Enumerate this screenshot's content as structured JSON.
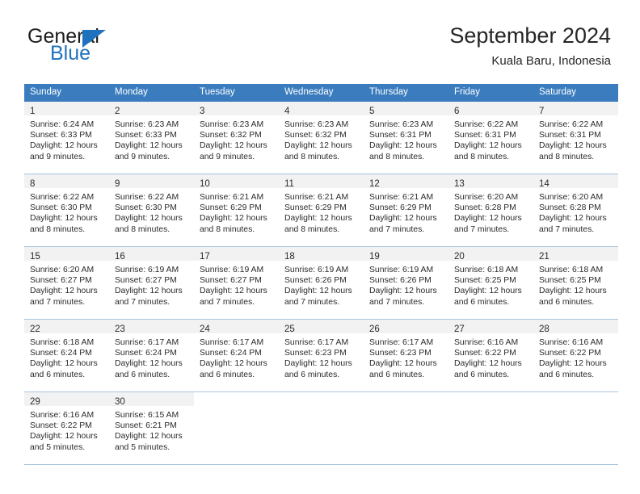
{
  "brand": {
    "word_one": "General",
    "word_two": "Blue",
    "flag_icon": "triangle-flag-icon",
    "accent_color": "#1f72bd"
  },
  "header": {
    "title": "September 2024",
    "location": "Kuala Baru, Indonesia"
  },
  "calendar": {
    "header_bg": "#3a7cbe",
    "daynum_bg": "#f2f2f2",
    "grid_line": "#a8c4dd",
    "weekdays": [
      "Sunday",
      "Monday",
      "Tuesday",
      "Wednesday",
      "Thursday",
      "Friday",
      "Saturday"
    ],
    "weeks": [
      [
        {
          "day": "1",
          "sunrise": "Sunrise: 6:24 AM",
          "sunset": "Sunset: 6:33 PM",
          "daylight_1": "Daylight: 12 hours",
          "daylight_2": "and 9 minutes."
        },
        {
          "day": "2",
          "sunrise": "Sunrise: 6:23 AM",
          "sunset": "Sunset: 6:33 PM",
          "daylight_1": "Daylight: 12 hours",
          "daylight_2": "and 9 minutes."
        },
        {
          "day": "3",
          "sunrise": "Sunrise: 6:23 AM",
          "sunset": "Sunset: 6:32 PM",
          "daylight_1": "Daylight: 12 hours",
          "daylight_2": "and 9 minutes."
        },
        {
          "day": "4",
          "sunrise": "Sunrise: 6:23 AM",
          "sunset": "Sunset: 6:32 PM",
          "daylight_1": "Daylight: 12 hours",
          "daylight_2": "and 8 minutes."
        },
        {
          "day": "5",
          "sunrise": "Sunrise: 6:23 AM",
          "sunset": "Sunset: 6:31 PM",
          "daylight_1": "Daylight: 12 hours",
          "daylight_2": "and 8 minutes."
        },
        {
          "day": "6",
          "sunrise": "Sunrise: 6:22 AM",
          "sunset": "Sunset: 6:31 PM",
          "daylight_1": "Daylight: 12 hours",
          "daylight_2": "and 8 minutes."
        },
        {
          "day": "7",
          "sunrise": "Sunrise: 6:22 AM",
          "sunset": "Sunset: 6:31 PM",
          "daylight_1": "Daylight: 12 hours",
          "daylight_2": "and 8 minutes."
        }
      ],
      [
        {
          "day": "8",
          "sunrise": "Sunrise: 6:22 AM",
          "sunset": "Sunset: 6:30 PM",
          "daylight_1": "Daylight: 12 hours",
          "daylight_2": "and 8 minutes."
        },
        {
          "day": "9",
          "sunrise": "Sunrise: 6:22 AM",
          "sunset": "Sunset: 6:30 PM",
          "daylight_1": "Daylight: 12 hours",
          "daylight_2": "and 8 minutes."
        },
        {
          "day": "10",
          "sunrise": "Sunrise: 6:21 AM",
          "sunset": "Sunset: 6:29 PM",
          "daylight_1": "Daylight: 12 hours",
          "daylight_2": "and 8 minutes."
        },
        {
          "day": "11",
          "sunrise": "Sunrise: 6:21 AM",
          "sunset": "Sunset: 6:29 PM",
          "daylight_1": "Daylight: 12 hours",
          "daylight_2": "and 8 minutes."
        },
        {
          "day": "12",
          "sunrise": "Sunrise: 6:21 AM",
          "sunset": "Sunset: 6:29 PM",
          "daylight_1": "Daylight: 12 hours",
          "daylight_2": "and 7 minutes."
        },
        {
          "day": "13",
          "sunrise": "Sunrise: 6:20 AM",
          "sunset": "Sunset: 6:28 PM",
          "daylight_1": "Daylight: 12 hours",
          "daylight_2": "and 7 minutes."
        },
        {
          "day": "14",
          "sunrise": "Sunrise: 6:20 AM",
          "sunset": "Sunset: 6:28 PM",
          "daylight_1": "Daylight: 12 hours",
          "daylight_2": "and 7 minutes."
        }
      ],
      [
        {
          "day": "15",
          "sunrise": "Sunrise: 6:20 AM",
          "sunset": "Sunset: 6:27 PM",
          "daylight_1": "Daylight: 12 hours",
          "daylight_2": "and 7 minutes."
        },
        {
          "day": "16",
          "sunrise": "Sunrise: 6:19 AM",
          "sunset": "Sunset: 6:27 PM",
          "daylight_1": "Daylight: 12 hours",
          "daylight_2": "and 7 minutes."
        },
        {
          "day": "17",
          "sunrise": "Sunrise: 6:19 AM",
          "sunset": "Sunset: 6:27 PM",
          "daylight_1": "Daylight: 12 hours",
          "daylight_2": "and 7 minutes."
        },
        {
          "day": "18",
          "sunrise": "Sunrise: 6:19 AM",
          "sunset": "Sunset: 6:26 PM",
          "daylight_1": "Daylight: 12 hours",
          "daylight_2": "and 7 minutes."
        },
        {
          "day": "19",
          "sunrise": "Sunrise: 6:19 AM",
          "sunset": "Sunset: 6:26 PM",
          "daylight_1": "Daylight: 12 hours",
          "daylight_2": "and 7 minutes."
        },
        {
          "day": "20",
          "sunrise": "Sunrise: 6:18 AM",
          "sunset": "Sunset: 6:25 PM",
          "daylight_1": "Daylight: 12 hours",
          "daylight_2": "and 6 minutes."
        },
        {
          "day": "21",
          "sunrise": "Sunrise: 6:18 AM",
          "sunset": "Sunset: 6:25 PM",
          "daylight_1": "Daylight: 12 hours",
          "daylight_2": "and 6 minutes."
        }
      ],
      [
        {
          "day": "22",
          "sunrise": "Sunrise: 6:18 AM",
          "sunset": "Sunset: 6:24 PM",
          "daylight_1": "Daylight: 12 hours",
          "daylight_2": "and 6 minutes."
        },
        {
          "day": "23",
          "sunrise": "Sunrise: 6:17 AM",
          "sunset": "Sunset: 6:24 PM",
          "daylight_1": "Daylight: 12 hours",
          "daylight_2": "and 6 minutes."
        },
        {
          "day": "24",
          "sunrise": "Sunrise: 6:17 AM",
          "sunset": "Sunset: 6:24 PM",
          "daylight_1": "Daylight: 12 hours",
          "daylight_2": "and 6 minutes."
        },
        {
          "day": "25",
          "sunrise": "Sunrise: 6:17 AM",
          "sunset": "Sunset: 6:23 PM",
          "daylight_1": "Daylight: 12 hours",
          "daylight_2": "and 6 minutes."
        },
        {
          "day": "26",
          "sunrise": "Sunrise: 6:17 AM",
          "sunset": "Sunset: 6:23 PM",
          "daylight_1": "Daylight: 12 hours",
          "daylight_2": "and 6 minutes."
        },
        {
          "day": "27",
          "sunrise": "Sunrise: 6:16 AM",
          "sunset": "Sunset: 6:22 PM",
          "daylight_1": "Daylight: 12 hours",
          "daylight_2": "and 6 minutes."
        },
        {
          "day": "28",
          "sunrise": "Sunrise: 6:16 AM",
          "sunset": "Sunset: 6:22 PM",
          "daylight_1": "Daylight: 12 hours",
          "daylight_2": "and 6 minutes."
        }
      ],
      [
        {
          "day": "29",
          "sunrise": "Sunrise: 6:16 AM",
          "sunset": "Sunset: 6:22 PM",
          "daylight_1": "Daylight: 12 hours",
          "daylight_2": "and 5 minutes."
        },
        {
          "day": "30",
          "sunrise": "Sunrise: 6:15 AM",
          "sunset": "Sunset: 6:21 PM",
          "daylight_1": "Daylight: 12 hours",
          "daylight_2": "and 5 minutes."
        },
        {
          "day": "",
          "sunrise": "",
          "sunset": "",
          "daylight_1": "",
          "daylight_2": ""
        },
        {
          "day": "",
          "sunrise": "",
          "sunset": "",
          "daylight_1": "",
          "daylight_2": ""
        },
        {
          "day": "",
          "sunrise": "",
          "sunset": "",
          "daylight_1": "",
          "daylight_2": ""
        },
        {
          "day": "",
          "sunrise": "",
          "sunset": "",
          "daylight_1": "",
          "daylight_2": ""
        },
        {
          "day": "",
          "sunrise": "",
          "sunset": "",
          "daylight_1": "",
          "daylight_2": ""
        }
      ]
    ]
  }
}
